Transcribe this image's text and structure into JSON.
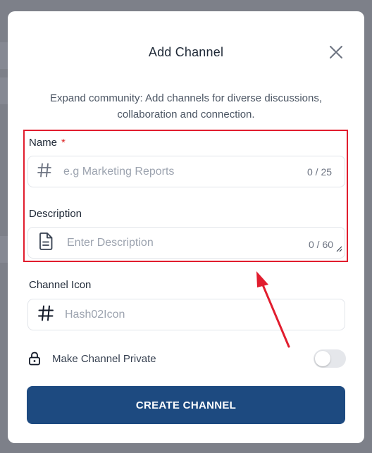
{
  "modal": {
    "title": "Add Channel",
    "subtitle": "Expand community: Add channels for diverse discussions, collaboration and connection."
  },
  "name_field": {
    "label": "Name",
    "required_mark": "*",
    "placeholder": "e.g Marketing Reports",
    "value": "",
    "counter": "0 / 25",
    "icon": "hash-icon"
  },
  "description_field": {
    "label": "Description",
    "placeholder": "Enter Description",
    "value": "",
    "counter": "0 / 60",
    "icon": "document-icon"
  },
  "channel_icon_field": {
    "label": "Channel Icon",
    "value": "Hash02Icon",
    "icon": "hash-icon"
  },
  "private_toggle": {
    "label": "Make Channel Private",
    "icon": "lock-icon",
    "checked": false
  },
  "create_button": {
    "label": "CREATE CHANNEL"
  },
  "colors": {
    "primary": "#1d4a80",
    "required": "#dc2626",
    "annotation": "#e11d2e",
    "backdrop": "#7d8089"
  },
  "annotations": {
    "highlight_box": "red-rectangle",
    "pointer": "red-arrow"
  }
}
